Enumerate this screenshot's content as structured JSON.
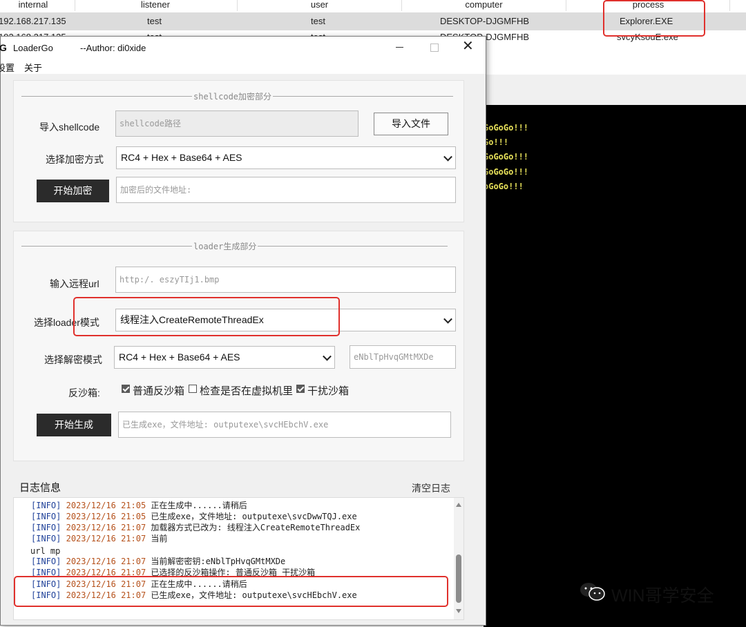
{
  "session_table": {
    "columns": [
      "internal",
      "listener",
      "user",
      "computer",
      "process"
    ],
    "rows": [
      {
        "internal": "192.168.217.135",
        "listener": "test",
        "user": "test",
        "computer": "DESKTOP-DJGMFHB",
        "process": "Explorer.EXE"
      },
      {
        "internal": "192.168.217.135",
        "listener": "test",
        "user": "test",
        "computer": "DESKTOP-DJGMFHB",
        "process": "svcyKsouE.exe"
      }
    ]
  },
  "console": {
    "lines": [
      "GoGoGo!!!",
      "Go!!!",
      "GoGoGo!!!",
      "GoGoGo!!!",
      "oGoGo!!!"
    ]
  },
  "window": {
    "icon": "G",
    "title": "LoaderGo",
    "author": "--Author: di0xide",
    "menu": [
      "设置",
      "关于"
    ]
  },
  "encrypt_section": {
    "legend": "shellcode加密部分",
    "shellcode_label": "导入shellcode",
    "shellcode_placeholder": "shellcode路径",
    "import_button": "导入文件",
    "method_label": "选择加密方式",
    "method_value": "RC4 + Hex + Base64 + AES",
    "encrypt_button": "开始加密",
    "output_placeholder": "加密后的文件地址:"
  },
  "loader_section": {
    "legend": "loader生成部分",
    "url_label": "输入远程url",
    "url_value": "http:/.                              eszyTIj1.bmp",
    "mode_label": "选择loader模式",
    "mode_value": "线程注入CreateRemoteThreadEx",
    "decrypt_label": "选择解密模式",
    "decrypt_value": "RC4 + Hex + Base64 + AES",
    "key_value": "eNblTpHvqGMtMXDe",
    "sandbox_label": "反沙箱:",
    "sandbox_options": [
      {
        "label": "普通反沙箱",
        "checked": true
      },
      {
        "label": "检查是否在虚拟机里",
        "checked": false
      },
      {
        "label": "干扰沙箱",
        "checked": true
      }
    ],
    "generate_button": "开始生成",
    "generate_output": "已生成exe，文件地址: outputexe\\svcHEbchV.exe"
  },
  "log_section": {
    "title": "日志信息",
    "clear_button": "清空日志",
    "entries": [
      {
        "tag": "[INFO]",
        "date": "2023/12/16 21:05",
        "msg": "正在生成中......请稍后"
      },
      {
        "tag": "[INFO]",
        "date": "2023/12/16 21:05",
        "msg": "已生成exe，文件地址: outputexe\\svcDwwTQJ.exe"
      },
      {
        "tag": "[INFO]",
        "date": "2023/12/16 21:07",
        "msg": "加载器方式已改为: 线程注入CreateRemoteThreadEx"
      },
      {
        "tag": "[INFO]",
        "date": "2023/12/16 21:07",
        "msg": "当前"
      },
      {
        "tag": "",
        "date": "",
        "msg": "url                                  mp"
      },
      {
        "tag": "[INFO]",
        "date": "2023/12/16 21:07",
        "msg": "当前解密密钥:eNblTpHvqGMtMXDe"
      },
      {
        "tag": "[INFO]",
        "date": "2023/12/16 21:07",
        "msg": "已选择的反沙箱操作: 普通反沙箱 干扰沙箱"
      },
      {
        "tag": "[INFO]",
        "date": "2023/12/16 21:07",
        "msg": "正在生成中......请稍后"
      },
      {
        "tag": "[INFO]",
        "date": "2023/12/16 21:07",
        "msg": "已生成exe，文件地址: outputexe\\svcHEbchV.exe"
      }
    ]
  },
  "watermark": "WIN哥学安全"
}
